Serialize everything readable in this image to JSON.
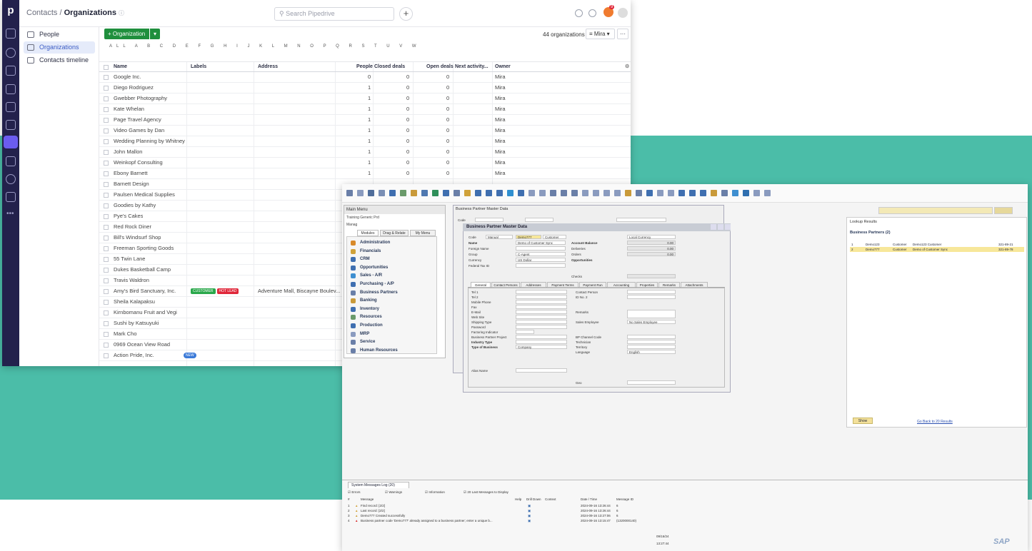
{
  "pipedrive": {
    "breadcrumb_parent": "Contacts /",
    "breadcrumb_current": "Organizations",
    "search_placeholder": "Search Pipedrive",
    "notification_count": "9",
    "sidebar": [
      {
        "label": "People"
      },
      {
        "label": "Organizations"
      },
      {
        "label": "Contacts timeline"
      }
    ],
    "add_button": "+ Organization",
    "count_text": "44 organizations",
    "filter_label": "Mira",
    "alphabet": "ALL A B C D E F G H I J K L M N O P Q R S T U V W",
    "columns": [
      "Name",
      "Labels",
      "Address",
      "People",
      "Closed deals",
      "Open deals",
      "Next activity...",
      "Owner"
    ],
    "rows": [
      {
        "name": "Google Inc.",
        "labels": [],
        "address": "",
        "people": "0",
        "closed": "0",
        "open": "0",
        "owner": "Mira"
      },
      {
        "name": "Diego Rodriguez",
        "labels": [],
        "address": "",
        "people": "1",
        "closed": "0",
        "open": "0",
        "owner": "Mira"
      },
      {
        "name": "Gwebber Photography",
        "labels": [],
        "address": "",
        "people": "1",
        "closed": "0",
        "open": "0",
        "owner": "Mira"
      },
      {
        "name": "Kate Whelan",
        "labels": [],
        "address": "",
        "people": "1",
        "closed": "0",
        "open": "0",
        "owner": "Mira"
      },
      {
        "name": "Page Travel Agency",
        "labels": [],
        "address": "",
        "people": "1",
        "closed": "0",
        "open": "0",
        "owner": "Mira"
      },
      {
        "name": "Video Games by Dan",
        "labels": [],
        "address": "",
        "people": "1",
        "closed": "0",
        "open": "0",
        "owner": "Mira"
      },
      {
        "name": "Wedding Planning by Whitney",
        "labels": [],
        "address": "",
        "people": "1",
        "closed": "0",
        "open": "0",
        "owner": "Mira"
      },
      {
        "name": "John Mallon",
        "labels": [],
        "address": "",
        "people": "1",
        "closed": "0",
        "open": "0",
        "owner": "Mira"
      },
      {
        "name": "Weinkopf Consulting",
        "labels": [],
        "address": "",
        "people": "1",
        "closed": "0",
        "open": "0",
        "owner": "Mira"
      },
      {
        "name": "Ebony Barnett",
        "labels": [],
        "address": "",
        "people": "1",
        "closed": "0",
        "open": "0",
        "owner": "Mira"
      },
      {
        "name": "Barnett Design",
        "labels": [],
        "address": "",
        "people": "",
        "closed": "",
        "open": "",
        "owner": ""
      },
      {
        "name": "Paulsen Medical Supplies",
        "labels": [],
        "address": "",
        "people": "",
        "closed": "",
        "open": "",
        "owner": ""
      },
      {
        "name": "Goodies by Kathy",
        "labels": [],
        "address": "",
        "people": "",
        "closed": "",
        "open": "",
        "owner": ""
      },
      {
        "name": "Pye's Cakes",
        "labels": [],
        "address": "",
        "people": "",
        "closed": "",
        "open": "",
        "owner": ""
      },
      {
        "name": "Red Rock Diner",
        "labels": [],
        "address": "",
        "people": "",
        "closed": "",
        "open": "",
        "owner": ""
      },
      {
        "name": "Bill's Windsurf Shop",
        "labels": [],
        "address": "",
        "people": "",
        "closed": "",
        "open": "",
        "owner": ""
      },
      {
        "name": "Freeman Sporting Goods",
        "labels": [],
        "address": "",
        "people": "",
        "closed": "",
        "open": "",
        "owner": ""
      },
      {
        "name": "55 Twin Lane",
        "labels": [],
        "address": "",
        "people": "",
        "closed": "",
        "open": "",
        "owner": ""
      },
      {
        "name": "Dukes Basketball Camp",
        "labels": [],
        "address": "",
        "people": "",
        "closed": "",
        "open": "",
        "owner": ""
      },
      {
        "name": "Travis Waldron",
        "labels": [],
        "address": "",
        "people": "",
        "closed": "",
        "open": "",
        "owner": ""
      },
      {
        "name": "Amy's Bird Sanctuary, Inc.",
        "labels": [
          {
            "text": "CUSTOMER",
            "color": "#2aa84b"
          },
          {
            "text": "HOT LEAD",
            "color": "#e0273a"
          }
        ],
        "address": "Adventure Mall, Biscayne Boulev...",
        "people": "",
        "closed": "",
        "open": "",
        "owner": ""
      },
      {
        "name": "Sheila Kalapaksu",
        "labels": [],
        "address": "",
        "people": "",
        "closed": "",
        "open": "",
        "owner": ""
      },
      {
        "name": "Kirnbomanu Fruit and Vegi",
        "labels": [],
        "address": "",
        "people": "",
        "closed": "",
        "open": "",
        "owner": ""
      },
      {
        "name": "Sushi by Katsuyuki",
        "labels": [],
        "address": "",
        "people": "",
        "closed": "",
        "open": "",
        "owner": ""
      },
      {
        "name": "Mark Cho",
        "labels": [],
        "address": "",
        "people": "",
        "closed": "",
        "open": "",
        "owner": ""
      },
      {
        "name": "0969 Ocean View Road",
        "labels": [],
        "address": "",
        "people": "",
        "closed": "",
        "open": "",
        "owner": ""
      },
      {
        "name": "Action Pride, Inc.",
        "labels": [],
        "address": "",
        "people": "",
        "closed": "",
        "open": "",
        "owner": "",
        "badge": "NEW"
      }
    ]
  },
  "sap": {
    "main_menu_title": "Main Menu",
    "main_menu_sub1": "Training Generic Prd",
    "main_menu_sub2": "Manag",
    "tabs": [
      "Modules",
      "Drag & Relate",
      "My Menu"
    ],
    "modules": [
      "Administration",
      "Financials",
      "CRM",
      "Opportunities",
      "Sales - A/R",
      "Purchasing - A/P",
      "Business Partners",
      "Banking",
      "Inventory",
      "Resources",
      "Production",
      "MRP",
      "Service",
      "Human Resources"
    ],
    "bp_back_title": "Business Partner Master Data",
    "bp_title": "Business Partner Master Data",
    "code_label": "Code",
    "code_mode": "Manual",
    "code_value": "Demo777",
    "type_value": "Customer",
    "local_currency": "Local Currency",
    "fields_left": [
      "Name",
      "Foreign Name",
      "Group",
      "Currency",
      "Federal Tax ID"
    ],
    "name_value": "Demo of Customer Sync",
    "group_value": "C-Agent",
    "currency_value": "US Dollar",
    "fields_right": [
      "Account Balance",
      "Deliveries",
      "Orders",
      "Opportunities"
    ],
    "zeros": [
      "0.00",
      "0.00",
      "0.00"
    ],
    "checks_label": "Checks",
    "form_tabs": [
      "General",
      "Contact Persons",
      "Addresses",
      "Payment Terms",
      "Payment Run",
      "Accounting",
      "Properties",
      "Remarks",
      "Attachments"
    ],
    "general_left": [
      "Tel 1",
      "Tel 2",
      "Mobile Phone",
      "Fax",
      "E-Mail",
      "Web Site",
      "Shipping Type",
      "Password",
      "Factoring Indicator",
      "Business Partner Project",
      "Industry Type",
      "Type of Business",
      "Alias Name"
    ],
    "general_right": [
      "Contact Person",
      "ID No. 2",
      "Remarks",
      "Sales Employee",
      "BP Channel Code",
      "Technician",
      "Territory",
      "Language",
      "Geo"
    ],
    "sales_employee_value": "No Sales Employee",
    "type_of_business_value": "Company",
    "language_value": "English",
    "lookup_title": "Lookup Results",
    "lookup_group": "Business Partners (2)",
    "lookup_rows": [
      {
        "idx": "1",
        "code": "Demo123",
        "type": "Customer",
        "name": "Demo123 Customer",
        "id": "321-89-21"
      },
      {
        "idx": "2",
        "code": "Demo777",
        "type": "Customer",
        "name": "Demo of Customer Sync",
        "id": "321-89-78"
      }
    ],
    "lookup_link": "Go Back to 20 Results",
    "lookup_button": "Show",
    "messages_tab": "System Messages Log (20)",
    "msg_filters": [
      "Errors",
      "Warnings",
      "Information",
      "Last Messages to Display"
    ],
    "msg_filter_count": "20",
    "msg_cols": [
      "#",
      "Message",
      "Help",
      "Drill Down",
      "Context",
      "Date / Time",
      "Message ID"
    ],
    "messages": [
      {
        "idx": "1",
        "text": "Find record: [2/2]",
        "dt": "2024-09-16 13:26:44",
        "id": "6"
      },
      {
        "idx": "2",
        "text": "Last record: [2/2]",
        "dt": "2024-09-16 13:26:44",
        "id": "6"
      },
      {
        "idx": "3",
        "text": "Demo777 Created successfully",
        "dt": "2024-09-16 13:27:06",
        "id": "6"
      },
      {
        "idx": "4",
        "text": "Business partner code 'Demo777' already assigned to a business partner; enter a unique b...",
        "dt": "2024-09-16 13:15:47",
        "id": "(1320000140)"
      }
    ],
    "status_center_top": "09/16/24",
    "status_center_bottom": "13:27:44",
    "sap_logo": "SAP"
  }
}
